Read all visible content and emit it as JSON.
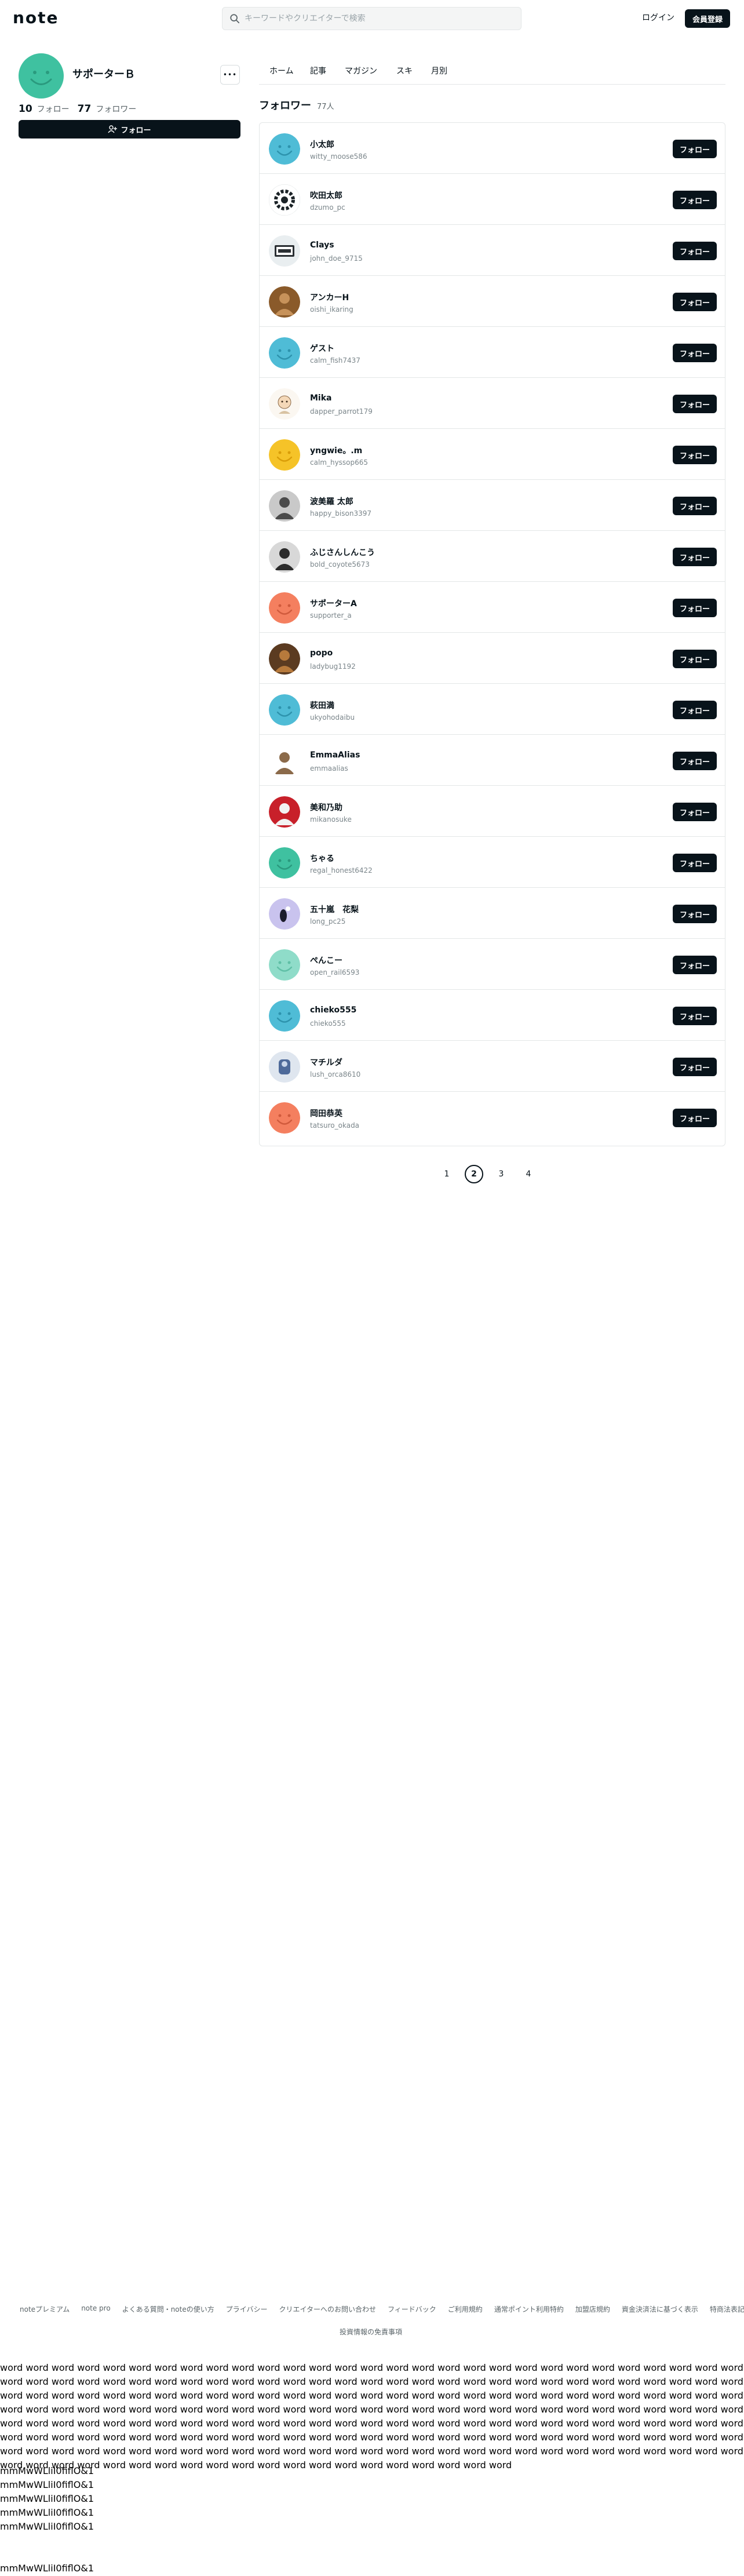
{
  "header": {
    "logo": "note",
    "search_placeholder": "キーワードやクリエイターで検索",
    "login_label": "ログイン",
    "signup_label": "会員登録"
  },
  "profile": {
    "name": "サポーターＢ",
    "more_label": "•••",
    "follow_count": "10",
    "follow_label": "フォロー",
    "follower_count": "77",
    "follower_label": "フォロワー",
    "follow_button_label": "フォロー",
    "avatar_color": "#3fc1a0"
  },
  "tabs": [
    "ホーム",
    "記事",
    "マガジン",
    "スキ",
    "月別"
  ],
  "followers": {
    "title": "フォロワー",
    "count_label": "77人",
    "follow_button_label": "フォロー",
    "items": [
      {
        "name": "小太郎",
        "id": "witty_moose586",
        "avatar": "smile-blue"
      },
      {
        "name": "吹田太郎",
        "id": "dzumo_pc",
        "avatar": "gear"
      },
      {
        "name": "Clays",
        "id": "john_doe_9715",
        "avatar": "logo-card"
      },
      {
        "name": "アンカーH",
        "id": "oishi_ikaring",
        "avatar": "photo-brown"
      },
      {
        "name": "ゲスト",
        "id": "calm_fish7437",
        "avatar": "smile-blue"
      },
      {
        "name": "Mika",
        "id": "dapper_parrot179",
        "avatar": "illustration"
      },
      {
        "name": "yngwie。.m",
        "id": "calm_hyssop665",
        "avatar": "smile-yellow"
      },
      {
        "name": "波美羅 太郎",
        "id": "happy_bison3397",
        "avatar": "photo-gray"
      },
      {
        "name": "ふじさんしんこう",
        "id": "bold_coyote5673",
        "avatar": "photo-car"
      },
      {
        "name": "サポーターA",
        "id": "supporter_a",
        "avatar": "smile-orange"
      },
      {
        "name": "popo",
        "id": "ladybug1192",
        "avatar": "photo-food"
      },
      {
        "name": "萩田満",
        "id": "ukyohodaibu",
        "avatar": "smile-blue"
      },
      {
        "name": "EmmaAlias",
        "id": "emmaalias",
        "avatar": "photo-figure"
      },
      {
        "name": "美和乃助",
        "id": "mikanosuke",
        "avatar": "photo-red"
      },
      {
        "name": "ちゃる",
        "id": "regal_honest6422",
        "avatar": "smile-green"
      },
      {
        "name": "五十嵐　花梨",
        "id": "long_pc25",
        "avatar": "illustration-purple"
      },
      {
        "name": "ぺんこー",
        "id": "open_rail6593",
        "avatar": "smile-mint"
      },
      {
        "name": "chieko555",
        "id": "chieko555",
        "avatar": "smile-blue"
      },
      {
        "name": "マチルダ",
        "id": "lush_orca8610",
        "avatar": "illustration-blue"
      },
      {
        "name": "岡田恭英",
        "id": "tatsuro_okada",
        "avatar": "smile-orange"
      }
    ]
  },
  "pagination": {
    "pages": [
      "1",
      "2",
      "3",
      "4"
    ],
    "current": "2"
  },
  "footer": {
    "links": [
      "noteプレミアム",
      "note pro",
      "よくある質問・noteの使い方",
      "プライバシー",
      "クリエイターへのお問い合わせ",
      "フィードバック",
      "ご利用規約",
      "通常ポイント利用特約",
      "加盟店規約",
      "資金決済法に基づく表示",
      "特商法表記"
    ],
    "link2": "投資情報の免責事項"
  },
  "raw_text": {
    "filler": "word word word word word word word word word word word word word word word word word word word word word word word word word word word word word word word word word word word word word word word word word word word word word word word word word word word word word word word word word word word word word word word word word word word word word word word word word word word word word word word word word word word word word word word word word word word word word word word word word word word word word word word word word word word word word word word word word word word word word word word word word word word word word word word word word word word word word word word word word word word word word word word word word word word word word word word word word word word word word word word word word word word word word word word word word word word word word word word word word word word word word word word word word word word word word word word word word word word word word word word word word word word word word word word word word word word word word word word word word word word word word word word",
    "glyph_lines": [
      "mmMwWLliI0fiflO&1",
      "mmMwWLliI0fiflO&1",
      "mmMwWLliI0fiflO&1",
      "mmMwWLliI0fiflO&1",
      "mmMwWLliI0fiflO&1"
    ],
    "glyph_tail": "mmMwWLliI0fiflO&1"
  }
}
